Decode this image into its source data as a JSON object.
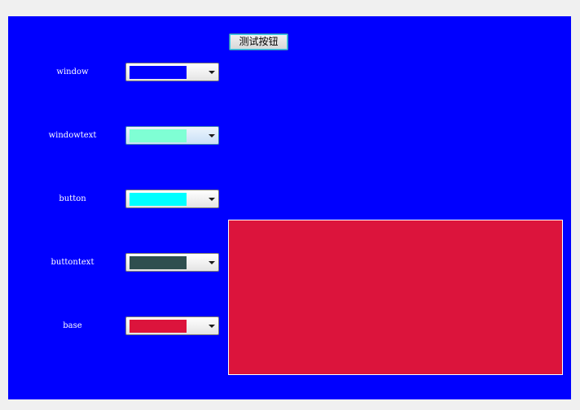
{
  "panel": {
    "background": "#0000ff"
  },
  "test_button": {
    "label": "测试按钮"
  },
  "roles": [
    {
      "label": "window",
      "color": "#0000ff"
    },
    {
      "label": "windowtext",
      "color": "#7fffd4"
    },
    {
      "label": "button",
      "color": "#00ffff"
    },
    {
      "label": "buttontext",
      "color": "#2f4f4f"
    },
    {
      "label": "base",
      "color": "#dc143c"
    }
  ],
  "preview": {
    "color": "#dc143c"
  }
}
